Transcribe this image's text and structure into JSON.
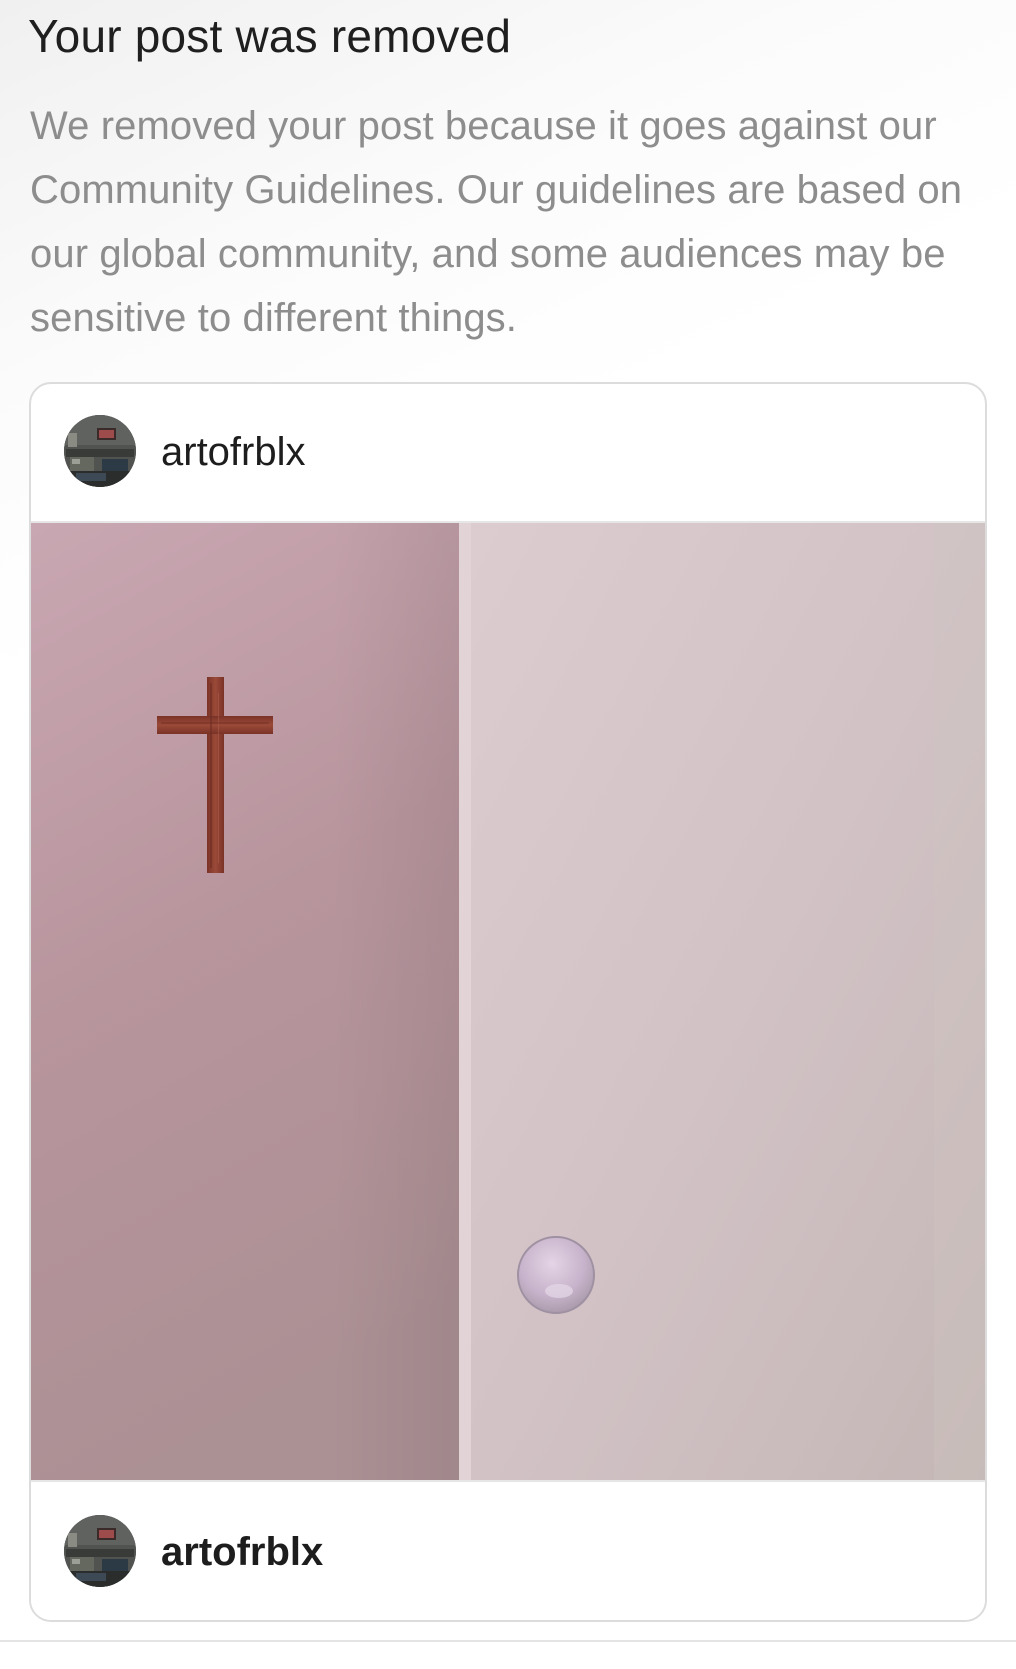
{
  "notice": {
    "title": "Your post was removed",
    "message": "We removed your post because it goes against our Community Guidelines. Our guidelines are based on our global community, and some audiences may be sensitive to different things."
  },
  "post": {
    "header_username": "artofrblx",
    "footer_username": "artofrblx",
    "media_icon": "removed-post-image"
  },
  "colors": {
    "title_text": "#1f1f1f",
    "message_text": "#8d8d8d",
    "card_border": "#dcdcdc",
    "wall_left": "#b9949d",
    "wall_right": "#d4c6c8",
    "cross": "#8a3a2c",
    "orb": "#cdbdd3"
  }
}
